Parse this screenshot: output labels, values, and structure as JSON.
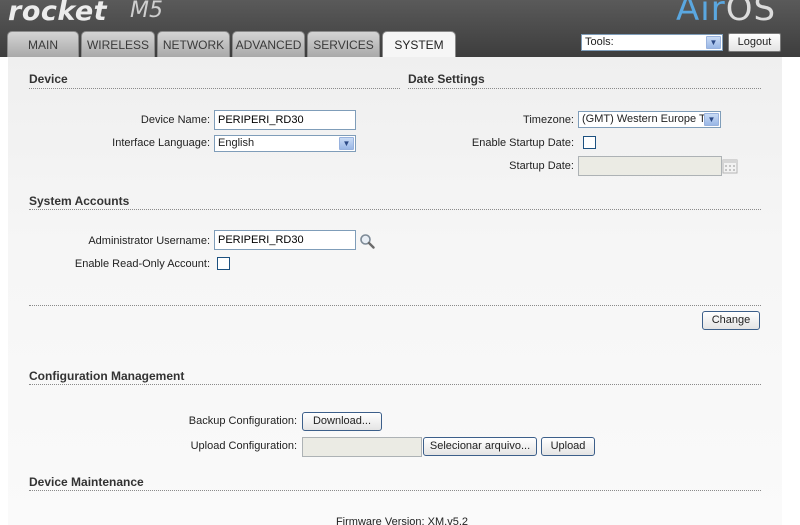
{
  "header": {
    "logo_rocket": "rocket",
    "logo_model": "M5",
    "logo_air": "Air",
    "logo_os": "OS",
    "tabs": [
      {
        "label": "MAIN"
      },
      {
        "label": "WIRELESS"
      },
      {
        "label": "NETWORK"
      },
      {
        "label": "ADVANCED"
      },
      {
        "label": "SERVICES"
      },
      {
        "label": "SYSTEM",
        "active": true
      }
    ],
    "tools_select": "Tools:",
    "logout": "Logout"
  },
  "device": {
    "title": "Device",
    "device_name_label": "Device Name:",
    "device_name_value": "PERIPERI_RD30",
    "language_label": "Interface Language:",
    "language_value": "English"
  },
  "date_settings": {
    "title": "Date Settings",
    "timezone_label": "Timezone:",
    "timezone_value": "(GMT) Western Europe Ti",
    "startup_date_enable_label": "Enable Startup Date:",
    "startup_date_label": "Startup Date:",
    "startup_date_value": ""
  },
  "system_accounts": {
    "title": "System Accounts",
    "admin_username_label": "Administrator Username:",
    "admin_username_value": "PERIPERI_RD30",
    "readonly_label": "Enable Read-Only Account:"
  },
  "change_button": "Change",
  "config_mgmt": {
    "title": "Configuration Management",
    "backup_label": "Backup Configuration:",
    "download_button": "Download...",
    "upload_label": "Upload Configuration:",
    "choose_file_button": "Selecionar arquivo...",
    "upload_button": "Upload"
  },
  "device_maintenance": {
    "title": "Device Maintenance",
    "firmware_line": "Firmware Version: XM.v5.2"
  },
  "colors": {
    "header_bg": "#4a4a4a",
    "airos_blue": "#5aa7e0",
    "panel_bg": "#f4f4f4"
  }
}
